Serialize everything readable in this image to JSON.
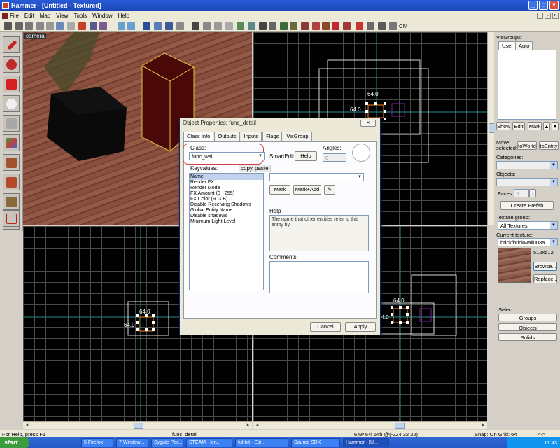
{
  "window": {
    "title": "Hammer - [Untitled - Textured]"
  },
  "menu": [
    "File",
    "Edit",
    "Map",
    "View",
    "Tools",
    "Window",
    "Help"
  ],
  "toolbar": {
    "cm_label": "CM"
  },
  "viewports": {
    "camera_label": "camera",
    "top_right": {
      "dim_top": "64.0",
      "dim_left": "64.0"
    },
    "bottom_left": {
      "dim_top": "64.0",
      "dim_left": "64.0"
    },
    "bottom_right": {
      "dim_top": "64.0",
      "dim_left": "64.0"
    }
  },
  "dialog": {
    "title": "Object Properties: func_detail",
    "tabs": [
      "Class Info",
      "Outputs",
      "Inputs",
      "Flags",
      "VisGroup"
    ],
    "class_label": "Class:",
    "class_value": "func_wall",
    "smartedit": "SmartEdit",
    "help_button": "Help",
    "angles_label": "Angles:",
    "angles_value": "0",
    "keyvalues_label": "Keyvalues:",
    "copy": "copy",
    "paste": "paste",
    "keyvalues": [
      "Name",
      "Render FX",
      "Render Mode",
      "FX Amount (0 - 255)",
      "FX Color (R G B)",
      "Disable Receiving Shadows",
      "Global Entity Name",
      "Disable shadows",
      "Minimum Light Level"
    ],
    "mark": "Mark",
    "mark_add": "Mark+Add",
    "help_label": "Help",
    "help_text": "The name that other entities refer to this entity by.",
    "comments_label": "Comments",
    "cancel": "Cancel",
    "apply": "Apply"
  },
  "rightpanel": {
    "visgroups_label": "VisGroups:",
    "tab_user": "User",
    "tab_auto": "Auto",
    "show": "Show",
    "edit": "Edit",
    "mark": "Mark",
    "move_selected": "Move selected:",
    "to_world": "toWorld",
    "to_entity": "toEntity",
    "categories": "Categories:",
    "objects": "Objects:",
    "faces": "Faces:",
    "faces_value": "1",
    "create_prefab": "Create Prefab",
    "texture_group_label": "Texture group:",
    "texture_group_value": "All Textures",
    "current_texture_label": "Current texture:",
    "current_texture_value": "brick/brickwall003a",
    "texture_size": "512x512",
    "browse": "Browse...",
    "replace": "Replace...",
    "select_label": "Select:",
    "groups": "Groups",
    "objects_btn": "Objects",
    "solids": "Solids"
  },
  "status": {
    "help": "For Help, press F1",
    "object": "func_detail",
    "size": "64w 64l 64h @(-224 32 32)",
    "snap": "Snap: On Grid: 64",
    "arrows": "<->"
  },
  "taskbar": {
    "start": "start",
    "tasks": [
      "5 Firefox",
      "7 Window...",
      "Sygate Per...",
      "STEAM - len...",
      "tut.txt - Edi...",
      "Source SDK",
      "Hammer - [U..."
    ],
    "clock": "17:43"
  },
  "colors": {
    "highlight_circle": "#d04040",
    "selection": "#ffffff",
    "brush_purple": "#800080"
  }
}
